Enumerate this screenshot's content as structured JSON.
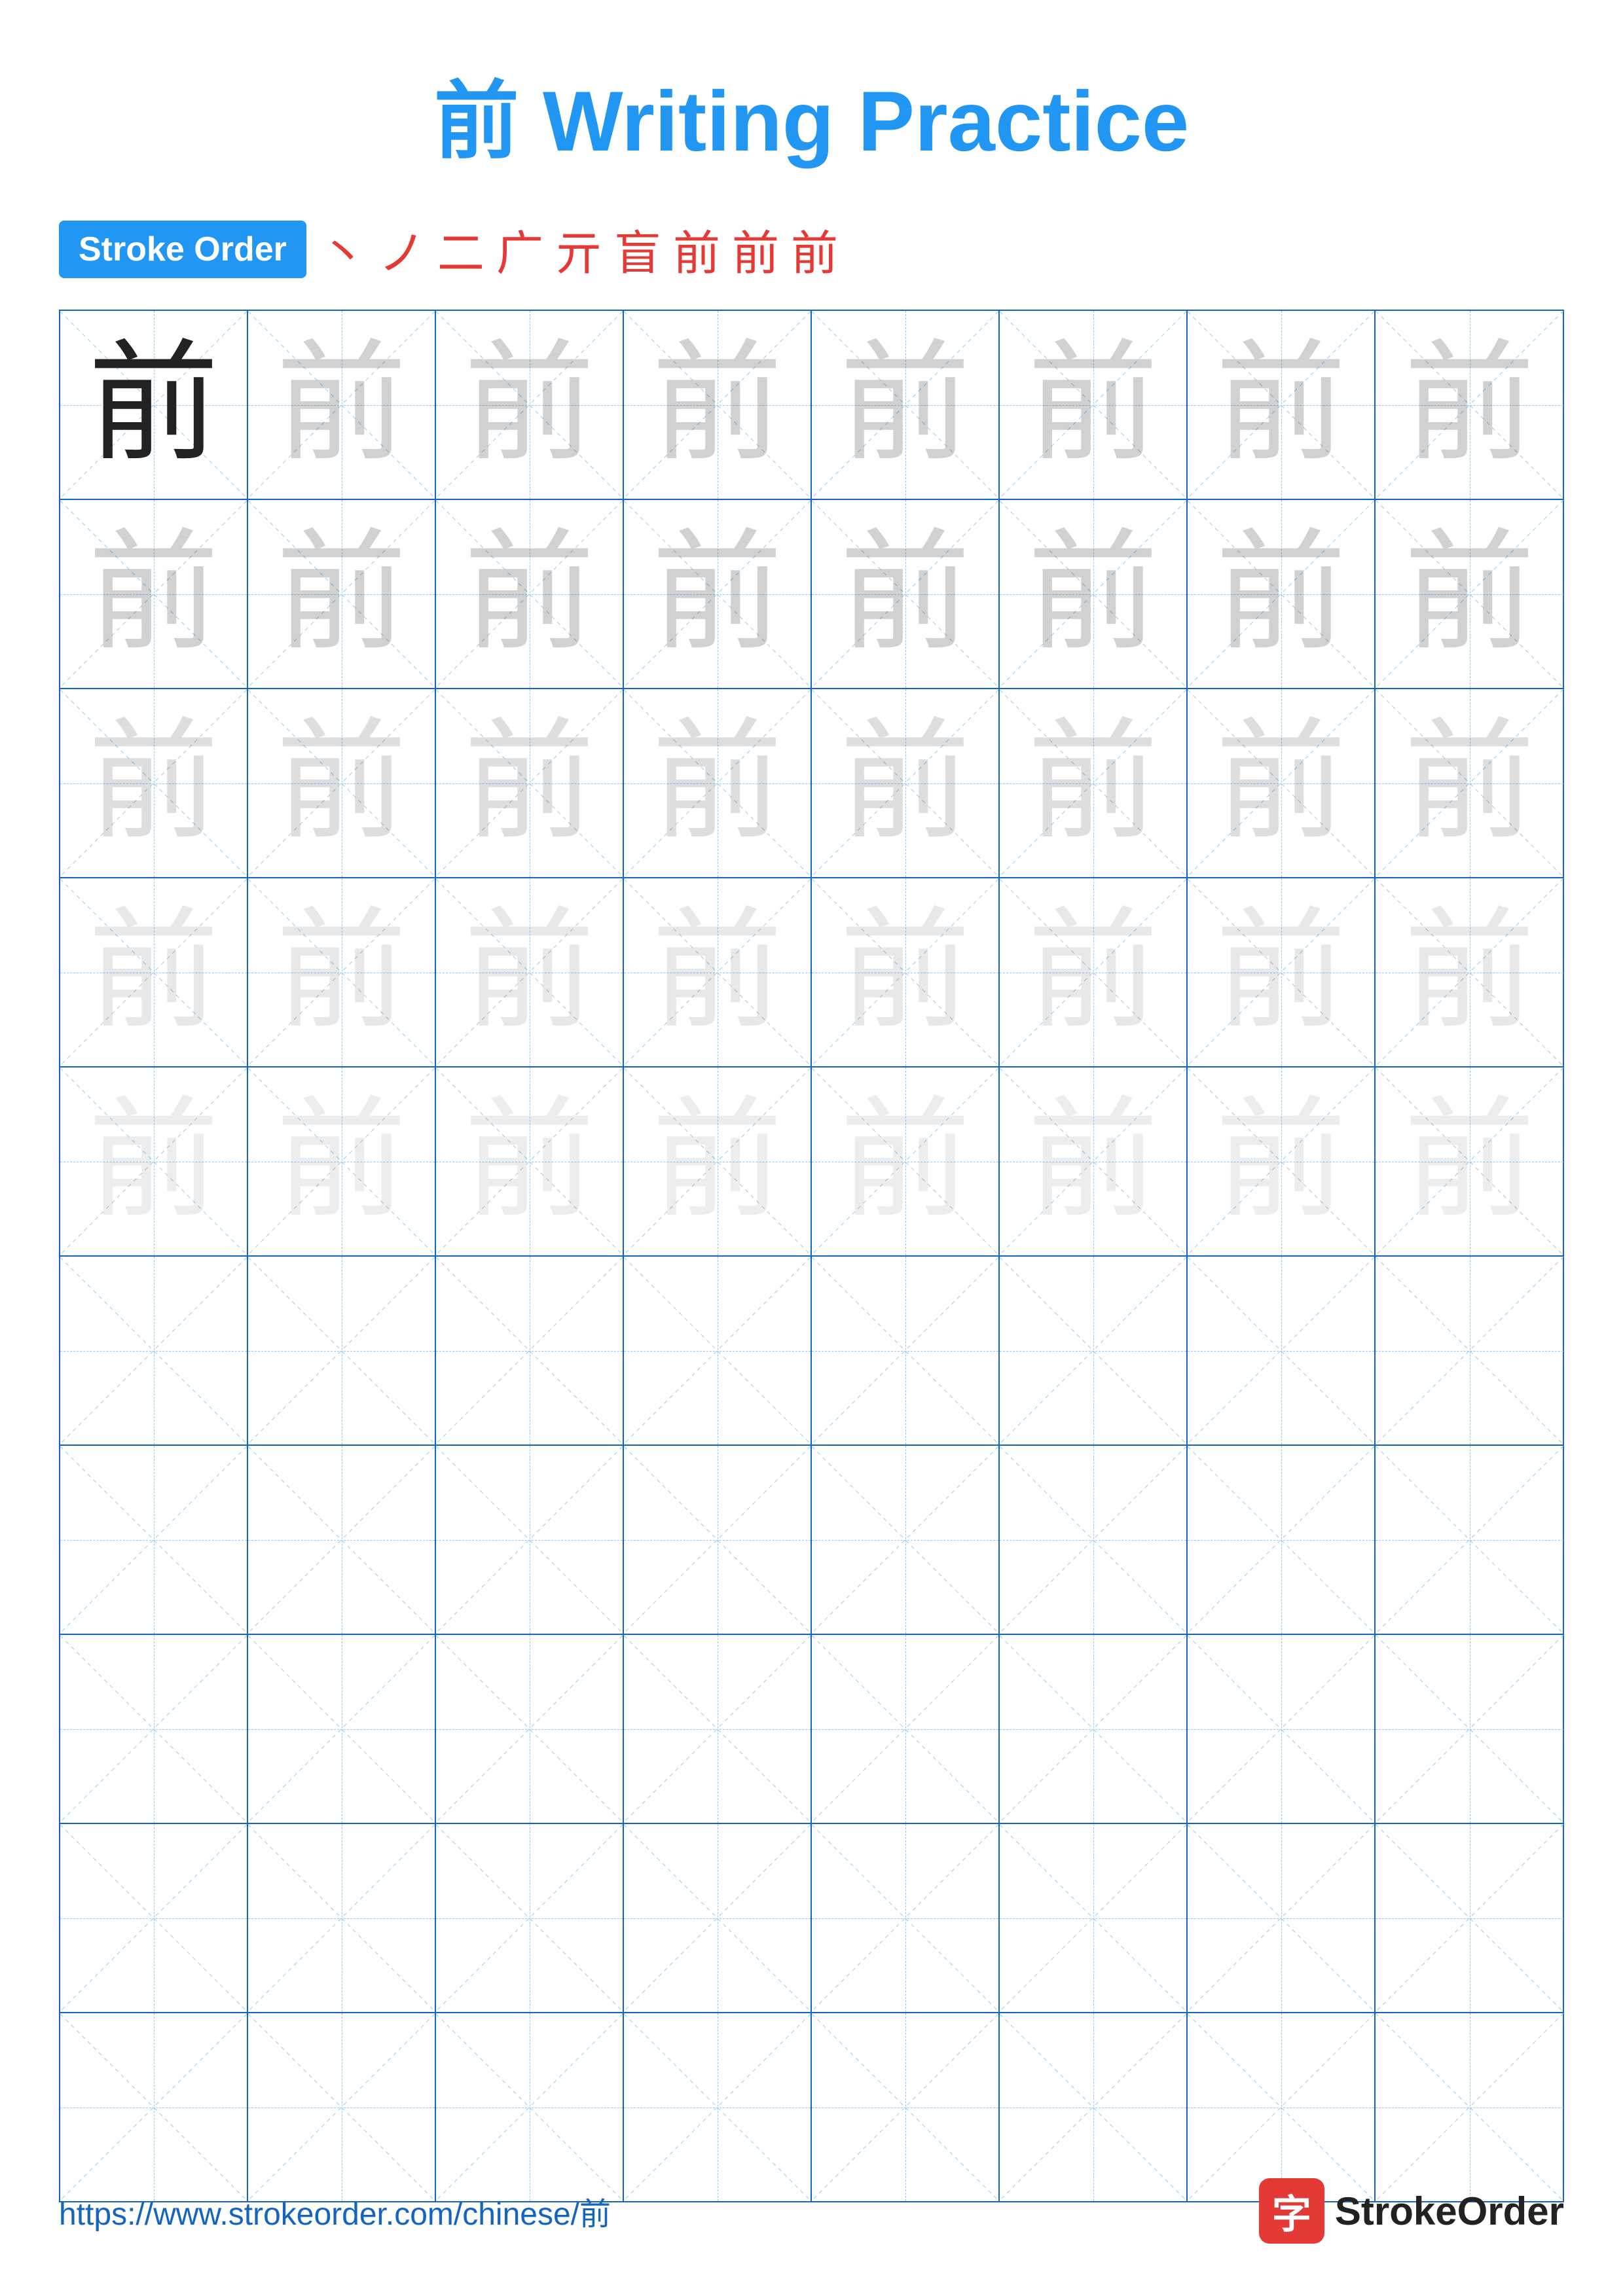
{
  "page": {
    "title_char": "前",
    "title_text": " Writing Practice"
  },
  "stroke_order": {
    "badge_label": "Stroke Order",
    "steps": [
      "丶",
      "ノ",
      "二",
      "广",
      "亓",
      "盲",
      "前",
      "前",
      "前"
    ]
  },
  "grid": {
    "rows": 10,
    "cols": 8,
    "char": "前",
    "practice_rows": 5,
    "empty_rows": 5
  },
  "footer": {
    "url": "https://www.strokeorder.com/chinese/前",
    "logo_char": "字",
    "logo_text": "StrokeOrder"
  }
}
